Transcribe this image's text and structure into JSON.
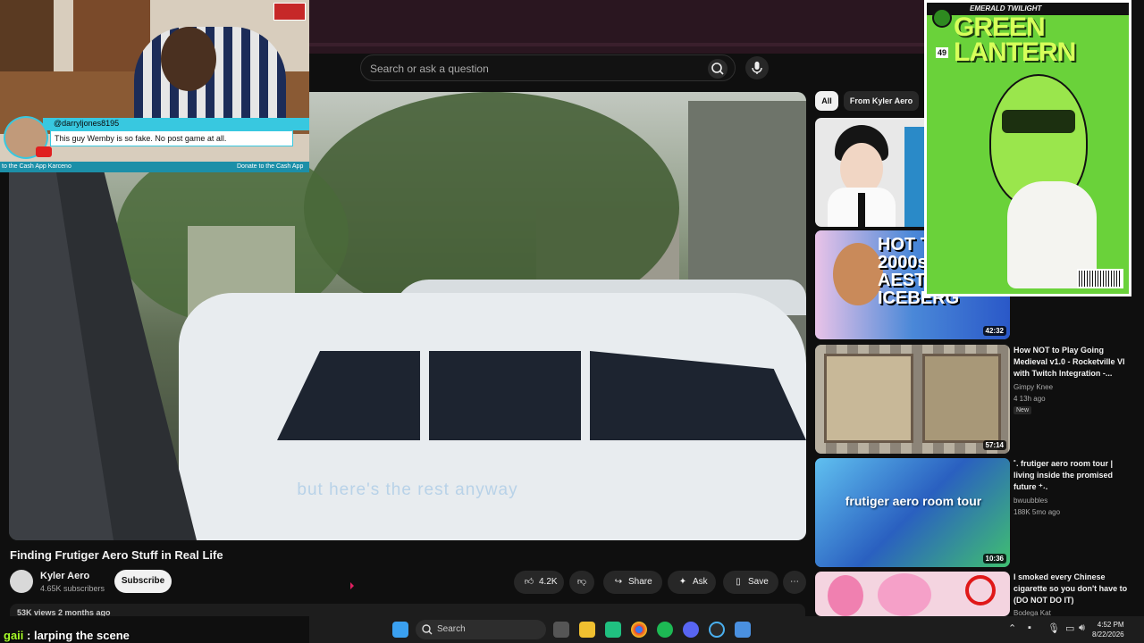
{
  "search": {
    "placeholder": "Search or ask a question"
  },
  "video": {
    "subtitle": "but here's the rest anyway",
    "title": "Finding Frutiger Aero Stuff in Real Life",
    "channel": "Kyler Aero",
    "subscribers": "4.65K subscribers",
    "subscribe_label": "Subscribe",
    "likes": "4.2K",
    "share_label": "Share",
    "ask_label": "Ask",
    "save_label": "Save",
    "meta": "53K views  2 months ago"
  },
  "webcam": {
    "chat_user": "@darryljones8195",
    "chat_message": "This guy Wemby is so fake. No post game at all.",
    "ticker_left": "to the Cash App Karceno",
    "ticker_right": "Donate to the Cash App"
  },
  "chips": [
    "All",
    "From Kyler Aero"
  ],
  "recommendations": [
    {
      "duration": "",
      "title": "",
      "channel": "",
      "meta": ""
    },
    {
      "duration": "42:32",
      "thumb_text": "HOT TOPIC 2000s AESTHETIC ICEBERG",
      "title": "",
      "channel": "",
      "meta": ""
    },
    {
      "duration": "57:14",
      "title": "How NOT to Play Going Medieval v1.0 - Rocketville VI with Twitch Integration -...",
      "channel": "Gimpy Knee",
      "meta": "4  13h ago",
      "badge": "New"
    },
    {
      "duration": "10:36",
      "thumb_text": "frutiger aero room tour",
      "title": "˚. frutiger aero room tour | living inside the promised future ⁺˖.",
      "channel": "bwuubbles",
      "meta": "188K  5mo ago"
    },
    {
      "duration": "",
      "title": "I smoked every Chinese cigarette so you don't have to (DO NOT DO IT)",
      "channel": "Bodega Kat",
      "meta": ""
    }
  ],
  "comic": {
    "subtitle": "EMERALD TWILIGHT",
    "title": "GREEN LANTERN",
    "issue": "49"
  },
  "stream_chat": {
    "user": "gaii",
    "message": " : larping the scene"
  },
  "taskbar": {
    "search_label": "Search",
    "time": "4:52 PM",
    "date": "8/22/2026"
  },
  "colors": {
    "accent": "#38c8e0",
    "youtube_red": "#e02020",
    "chat_user": "#a8ff2a"
  }
}
